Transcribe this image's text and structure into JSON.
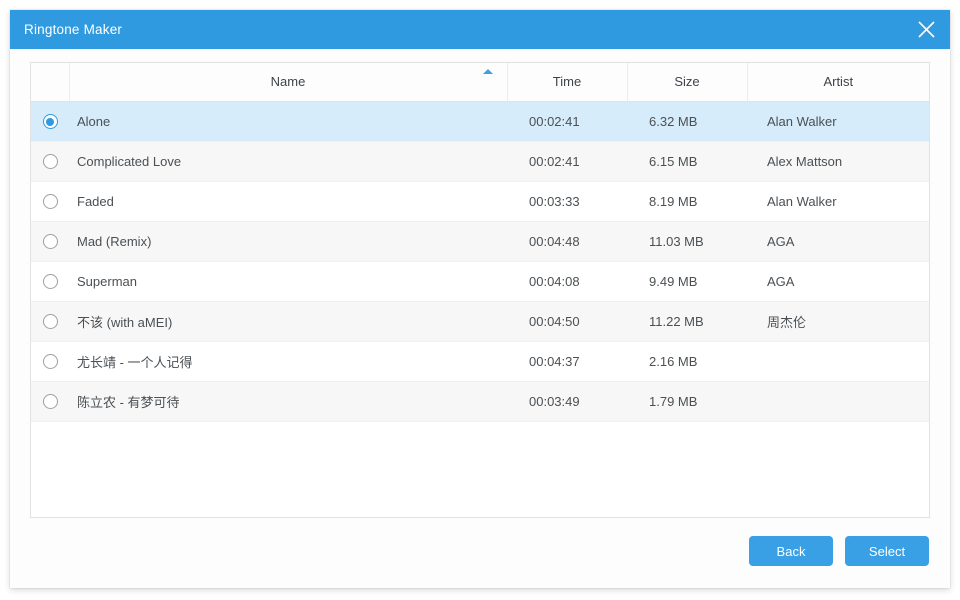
{
  "window": {
    "title": "Ringtone Maker",
    "close_icon": "close-icon",
    "accent_color": "#2f9ae0",
    "selected_row_color": "#d6ecfb"
  },
  "table": {
    "columns": [
      {
        "key": "radio",
        "label": ""
      },
      {
        "key": "name",
        "label": "Name",
        "sorted": "ascending",
        "sort_icon": "caret-up-icon"
      },
      {
        "key": "time",
        "label": "Time"
      },
      {
        "key": "size",
        "label": "Size"
      },
      {
        "key": "artist",
        "label": "Artist"
      }
    ],
    "rows": [
      {
        "selected": true,
        "name": "Alone",
        "time": "00:02:41",
        "size": "6.32 MB",
        "artist": "Alan Walker"
      },
      {
        "selected": false,
        "name": "Complicated Love",
        "time": "00:02:41",
        "size": "6.15 MB",
        "artist": "Alex Mattson"
      },
      {
        "selected": false,
        "name": "Faded",
        "time": "00:03:33",
        "size": "8.19 MB",
        "artist": "Alan Walker"
      },
      {
        "selected": false,
        "name": "Mad (Remix)",
        "time": "00:04:48",
        "size": "11.03 MB",
        "artist": "AGA"
      },
      {
        "selected": false,
        "name": "Superman",
        "time": "00:04:08",
        "size": "9.49 MB",
        "artist": "AGA"
      },
      {
        "selected": false,
        "name": "不该 (with aMEI)",
        "time": "00:04:50",
        "size": "11.22 MB",
        "artist": "周杰伦"
      },
      {
        "selected": false,
        "name": "尤长靖 - 一个人记得",
        "time": "00:04:37",
        "size": "2.16 MB",
        "artist": ""
      },
      {
        "selected": false,
        "name": "陈立农 - 有梦可待",
        "time": "00:03:49",
        "size": "1.79 MB",
        "artist": ""
      }
    ]
  },
  "footer": {
    "back_label": "Back",
    "select_label": "Select"
  }
}
